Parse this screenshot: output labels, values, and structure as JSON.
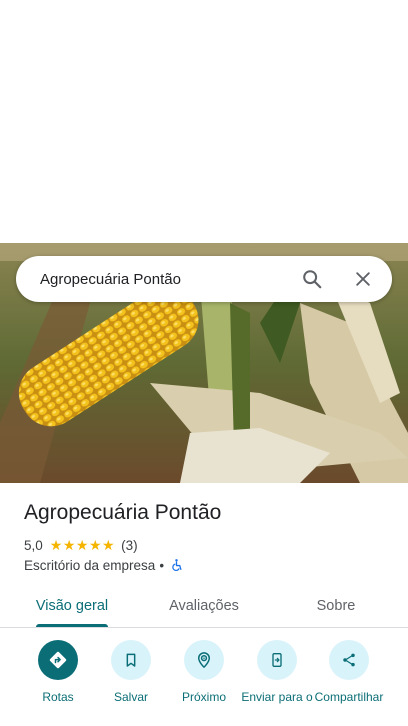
{
  "search": {
    "query": "Agropecuária Pontão"
  },
  "place": {
    "name": "Agropecuária Pontão",
    "rating": "5,0",
    "stars": 5,
    "review_count": "(3)",
    "category": "Escritório da empresa",
    "separator": "•"
  },
  "tabs": [
    {
      "label": "Visão geral",
      "active": true
    },
    {
      "label": "Avaliações",
      "active": false
    },
    {
      "label": "Sobre",
      "active": false
    }
  ],
  "actions": [
    {
      "label": "Rotas",
      "icon": "directions-icon"
    },
    {
      "label": "Salvar",
      "icon": "bookmark-icon"
    },
    {
      "label": "Próximo",
      "icon": "nearby-icon"
    },
    {
      "label": "Enviar para o",
      "icon": "send-to-phone-icon"
    },
    {
      "label": "Compartilhar",
      "icon": "share-icon"
    }
  ],
  "colors": {
    "accent": "#0b6e76",
    "action_bg": "#d9f3fb",
    "star": "#f4b400",
    "accessibility": "#1a73e8"
  }
}
